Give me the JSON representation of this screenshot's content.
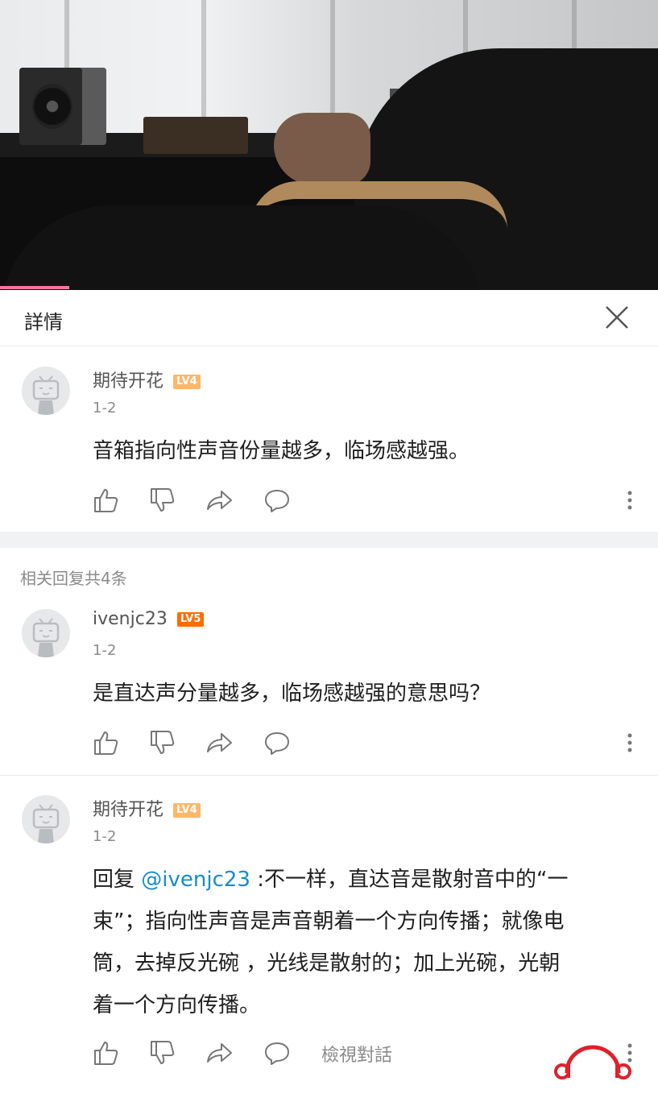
{
  "video": {
    "progress": 0.105
  },
  "header": {
    "title": "詳情"
  },
  "main_comment": {
    "username": "期待开花",
    "level": "LV4",
    "date": "1-2",
    "text": "音箱指向性声音份量越多，临场感越强。"
  },
  "replies": {
    "count_label": "相关回复共4条",
    "items": [
      {
        "username": "ivenjc23",
        "level": "LV5",
        "date": "1-2",
        "text": "是直达声分量越多，临场感越强的意思吗？"
      },
      {
        "username": "期待开花",
        "level": "LV4",
        "date": "1-2",
        "reply_prefix": "回复 ",
        "mention": "@ivenjc23",
        "text_line1": " :不一样，直达音是散射音中的“一",
        "text_line2": "束”；指向性声音是声音朝着一个方向传播；就像电",
        "text_line3": "筒，去掉反光碗 ，光线是散射的；加上光碗，光朝",
        "text_line4": "着一个方向传播。",
        "view_thread": "檢視對話"
      }
    ]
  },
  "colors": {
    "accent": "#fb7299",
    "mention": "#178bcf",
    "lv4": "#fdb66a",
    "lv5": "#ff6c00"
  }
}
